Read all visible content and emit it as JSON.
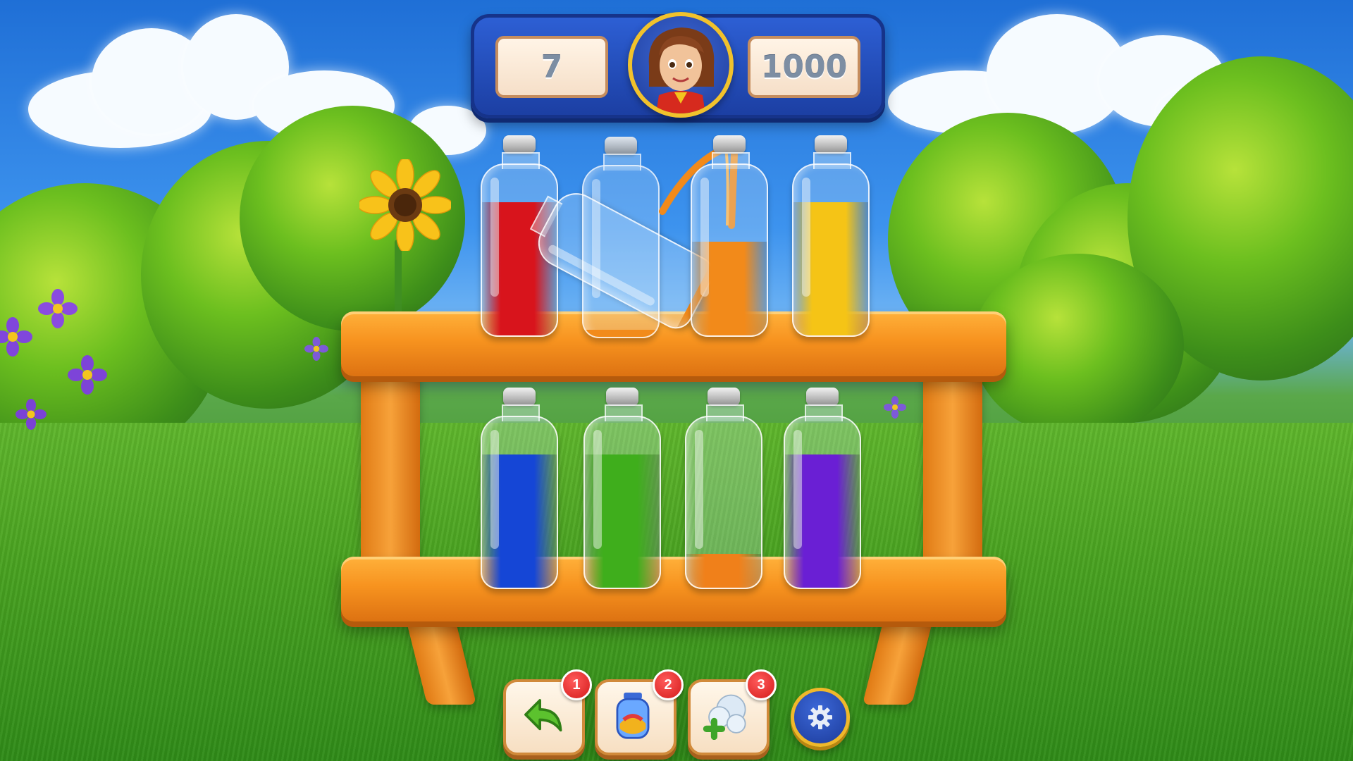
{
  "hud": {
    "moves": "7",
    "score": "1000",
    "avatar_icon": "character-portrait"
  },
  "shelves": {
    "top_row": [
      {
        "color": "#d8141c",
        "fill": 0.78
      },
      {
        "color": "#f28a1a",
        "fill": 0.04,
        "state": "tilted-pouring"
      },
      {
        "color": "#f28a1a",
        "fill": 0.55,
        "state": "receiving-splash"
      },
      {
        "color": "#f5c416",
        "fill": 0.78
      }
    ],
    "bottom_row": [
      {
        "color": "#1546d6",
        "fill": 0.78
      },
      {
        "color": "#3fae1c",
        "fill": 0.78
      },
      {
        "color": "#f0801a",
        "fill": 0.2
      },
      {
        "color": "#6a1fd4",
        "fill": 0.78
      }
    ]
  },
  "toolbar": {
    "undo": {
      "badge": "1",
      "icon": "undo-arrow-icon"
    },
    "extra_bottle": {
      "badge": "2",
      "icon": "bottle-potion-icon"
    },
    "shuffle": {
      "badge": "3",
      "icon": "bubbles-plus-icon"
    },
    "settings_icon": "gear-icon"
  },
  "colors": {
    "hud_blue": "#2d5fd4",
    "shelf_orange": "#f7931f",
    "badge_red": "#d41b1b"
  }
}
